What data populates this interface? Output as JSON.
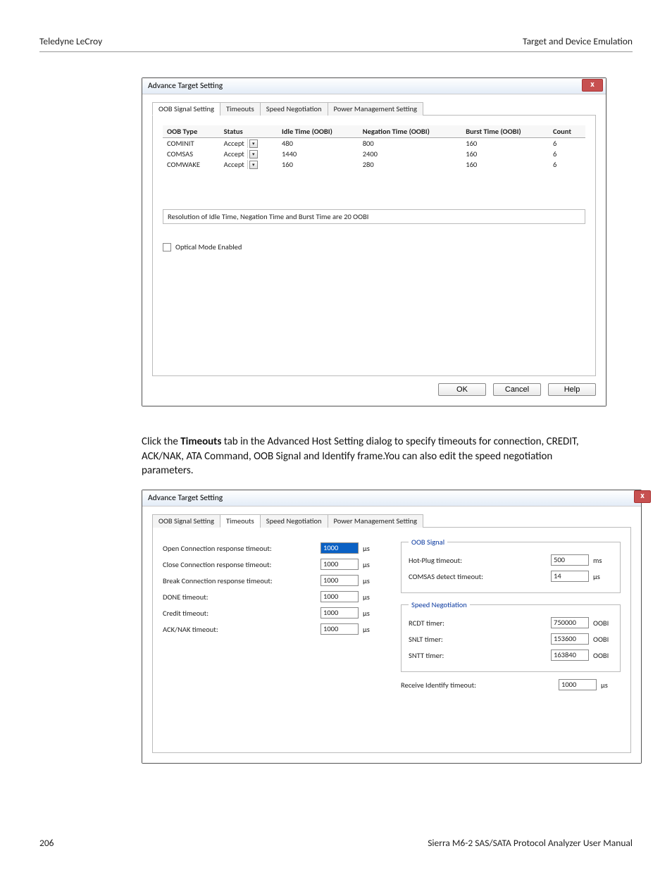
{
  "header": {
    "left": "Teledyne LeCroy",
    "right": "Target and Device Emulation"
  },
  "dialog1": {
    "title": "Advance Target Setting",
    "tabs": [
      "OOB Signal Setting",
      "Timeouts",
      "Speed Negotiation",
      "Power Management Setting"
    ],
    "active_tab": 0,
    "table": {
      "headers": [
        "OOB Type",
        "Status",
        "Idle Time (OOBI)",
        "Negation Time (OOBI)",
        "Burst Time (OOBI)",
        "Count"
      ],
      "rows": [
        {
          "type": "COMINIT",
          "status": "Accept",
          "idle": "480",
          "negation": "800",
          "burst": "160",
          "count": "6"
        },
        {
          "type": "COMSAS",
          "status": "Accept",
          "idle": "1440",
          "negation": "2400",
          "burst": "160",
          "count": "6"
        },
        {
          "type": "COMWAKE",
          "status": "Accept",
          "idle": "160",
          "negation": "280",
          "burst": "160",
          "count": "6"
        }
      ]
    },
    "note": "Resolution of Idle Time, Negation Time and Burst Time are 20 OOBI",
    "checkbox_label": "Optical Mode Enabled",
    "buttons": {
      "ok": "OK",
      "cancel": "Cancel",
      "help": "Help"
    }
  },
  "paragraph": {
    "pre": "Click the ",
    "bold": "Timeouts",
    "post": " tab in the Advanced Host Setting dialog to specify timeouts for connection, CREDIT, ACK/NAK, ATA Command, OOB Signal and Identify frame.You can also edit the speed negotiation parameters."
  },
  "dialog2": {
    "title": "Advance Target Setting",
    "tabs": [
      "OOB Signal Setting",
      "Timeouts",
      "Speed Negotiation",
      "Power Management Setting"
    ],
    "active_tab": 1,
    "left_fields": [
      {
        "label": "Open Connection response timeout:",
        "value": "1000",
        "unit": "µs",
        "hl": true
      },
      {
        "label": "Close Connection response timeout:",
        "value": "1000",
        "unit": "µs"
      },
      {
        "label": "Break Connection response timeout:",
        "value": "1000",
        "unit": "µs"
      },
      {
        "label": "DONE timeout:",
        "value": "1000",
        "unit": "µs"
      },
      {
        "label": "Credit timeout:",
        "value": "1000",
        "unit": "µs"
      },
      {
        "label": "ACK/NAK timeout:",
        "value": "1000",
        "unit": "µs"
      }
    ],
    "groups": {
      "oob": {
        "legend": "OOB Signal",
        "fields": [
          {
            "label": "Hot-Plug timeout:",
            "value": "500",
            "unit": "ms"
          },
          {
            "label": "COMSAS detect timeout:",
            "value": "14",
            "unit": "µs"
          }
        ]
      },
      "speed": {
        "legend": "Speed Negotiation",
        "fields": [
          {
            "label": "RCDT timer:",
            "value": "750000",
            "unit": "OOBI"
          },
          {
            "label": "SNLT timer:",
            "value": "153600",
            "unit": "OOBI"
          },
          {
            "label": "SNTT timer:",
            "value": "163840",
            "unit": "OOBI"
          }
        ]
      }
    },
    "extra_field": {
      "label": "Receive Identify timeout:",
      "value": "1000",
      "unit": "µs"
    }
  },
  "footer": {
    "left": "206",
    "right": "Sierra M6-2 SAS/SATA Protocol Analyzer User Manual"
  }
}
